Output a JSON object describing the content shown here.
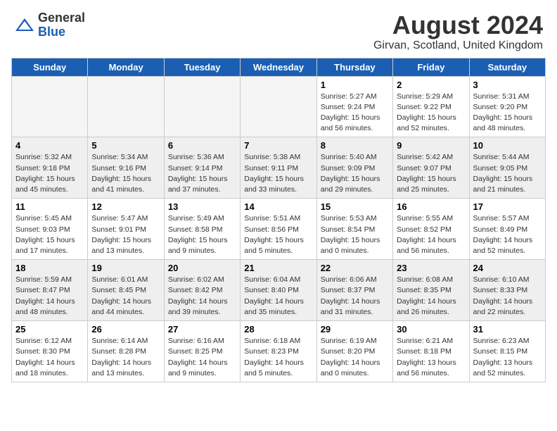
{
  "header": {
    "logo_general": "General",
    "logo_blue": "Blue",
    "title": "August 2024",
    "subtitle": "Girvan, Scotland, United Kingdom"
  },
  "calendar": {
    "days_of_week": [
      "Sunday",
      "Monday",
      "Tuesday",
      "Wednesday",
      "Thursday",
      "Friday",
      "Saturday"
    ],
    "weeks": [
      [
        {
          "day": "",
          "empty": true
        },
        {
          "day": "",
          "empty": true
        },
        {
          "day": "",
          "empty": true
        },
        {
          "day": "",
          "empty": true
        },
        {
          "day": "1",
          "sunrise": "5:27 AM",
          "sunset": "9:24 PM",
          "daylight": "15 hours and 56 minutes."
        },
        {
          "day": "2",
          "sunrise": "5:29 AM",
          "sunset": "9:22 PM",
          "daylight": "15 hours and 52 minutes."
        },
        {
          "day": "3",
          "sunrise": "5:31 AM",
          "sunset": "9:20 PM",
          "daylight": "15 hours and 48 minutes."
        }
      ],
      [
        {
          "day": "4",
          "sunrise": "5:32 AM",
          "sunset": "9:18 PM",
          "daylight": "15 hours and 45 minutes."
        },
        {
          "day": "5",
          "sunrise": "5:34 AM",
          "sunset": "9:16 PM",
          "daylight": "15 hours and 41 minutes."
        },
        {
          "day": "6",
          "sunrise": "5:36 AM",
          "sunset": "9:14 PM",
          "daylight": "15 hours and 37 minutes."
        },
        {
          "day": "7",
          "sunrise": "5:38 AM",
          "sunset": "9:11 PM",
          "daylight": "15 hours and 33 minutes."
        },
        {
          "day": "8",
          "sunrise": "5:40 AM",
          "sunset": "9:09 PM",
          "daylight": "15 hours and 29 minutes."
        },
        {
          "day": "9",
          "sunrise": "5:42 AM",
          "sunset": "9:07 PM",
          "daylight": "15 hours and 25 minutes."
        },
        {
          "day": "10",
          "sunrise": "5:44 AM",
          "sunset": "9:05 PM",
          "daylight": "15 hours and 21 minutes."
        }
      ],
      [
        {
          "day": "11",
          "sunrise": "5:45 AM",
          "sunset": "9:03 PM",
          "daylight": "15 hours and 17 minutes."
        },
        {
          "day": "12",
          "sunrise": "5:47 AM",
          "sunset": "9:01 PM",
          "daylight": "15 hours and 13 minutes."
        },
        {
          "day": "13",
          "sunrise": "5:49 AM",
          "sunset": "8:58 PM",
          "daylight": "15 hours and 9 minutes."
        },
        {
          "day": "14",
          "sunrise": "5:51 AM",
          "sunset": "8:56 PM",
          "daylight": "15 hours and 5 minutes."
        },
        {
          "day": "15",
          "sunrise": "5:53 AM",
          "sunset": "8:54 PM",
          "daylight": "15 hours and 0 minutes."
        },
        {
          "day": "16",
          "sunrise": "5:55 AM",
          "sunset": "8:52 PM",
          "daylight": "14 hours and 56 minutes."
        },
        {
          "day": "17",
          "sunrise": "5:57 AM",
          "sunset": "8:49 PM",
          "daylight": "14 hours and 52 minutes."
        }
      ],
      [
        {
          "day": "18",
          "sunrise": "5:59 AM",
          "sunset": "8:47 PM",
          "daylight": "14 hours and 48 minutes."
        },
        {
          "day": "19",
          "sunrise": "6:01 AM",
          "sunset": "8:45 PM",
          "daylight": "14 hours and 44 minutes."
        },
        {
          "day": "20",
          "sunrise": "6:02 AM",
          "sunset": "8:42 PM",
          "daylight": "14 hours and 39 minutes."
        },
        {
          "day": "21",
          "sunrise": "6:04 AM",
          "sunset": "8:40 PM",
          "daylight": "14 hours and 35 minutes."
        },
        {
          "day": "22",
          "sunrise": "6:06 AM",
          "sunset": "8:37 PM",
          "daylight": "14 hours and 31 minutes."
        },
        {
          "day": "23",
          "sunrise": "6:08 AM",
          "sunset": "8:35 PM",
          "daylight": "14 hours and 26 minutes."
        },
        {
          "day": "24",
          "sunrise": "6:10 AM",
          "sunset": "8:33 PM",
          "daylight": "14 hours and 22 minutes."
        }
      ],
      [
        {
          "day": "25",
          "sunrise": "6:12 AM",
          "sunset": "8:30 PM",
          "daylight": "14 hours and 18 minutes."
        },
        {
          "day": "26",
          "sunrise": "6:14 AM",
          "sunset": "8:28 PM",
          "daylight": "14 hours and 13 minutes."
        },
        {
          "day": "27",
          "sunrise": "6:16 AM",
          "sunset": "8:25 PM",
          "daylight": "14 hours and 9 minutes."
        },
        {
          "day": "28",
          "sunrise": "6:18 AM",
          "sunset": "8:23 PM",
          "daylight": "14 hours and 5 minutes."
        },
        {
          "day": "29",
          "sunrise": "6:19 AM",
          "sunset": "8:20 PM",
          "daylight": "14 hours and 0 minutes."
        },
        {
          "day": "30",
          "sunrise": "6:21 AM",
          "sunset": "8:18 PM",
          "daylight": "13 hours and 56 minutes."
        },
        {
          "day": "31",
          "sunrise": "6:23 AM",
          "sunset": "8:15 PM",
          "daylight": "13 hours and 52 minutes."
        }
      ]
    ]
  }
}
